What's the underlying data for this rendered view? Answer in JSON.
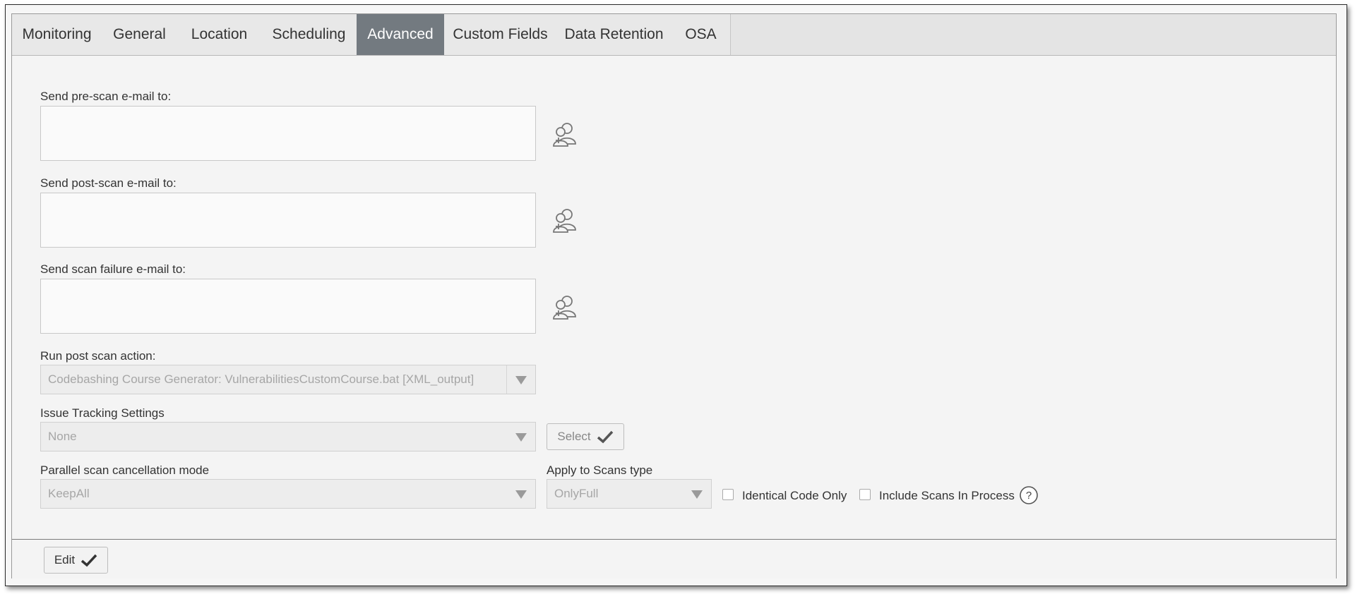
{
  "tabs": {
    "monitoring": "Monitoring",
    "general": "General",
    "location": "Location",
    "scheduling": "Scheduling",
    "advanced": "Advanced",
    "custom_fields": "Custom Fields",
    "data_retention": "Data Retention",
    "osa": "OSA"
  },
  "active_tab": "Advanced",
  "form": {
    "pre_scan_label": "Send pre-scan e-mail to:",
    "post_scan_label": "Send post-scan e-mail to:",
    "failure_label": "Send scan failure e-mail to:",
    "pre_scan_value": "",
    "post_scan_value": "",
    "failure_value": "",
    "post_action_label": "Run post scan action:",
    "post_action_value": "Codebashing Course Generator: VulnerabilitiesCustomCourse.bat [XML_output]",
    "issue_tracking_label": "Issue Tracking Settings",
    "issue_tracking_value": "None",
    "select_button": "Select",
    "parallel_label": "Parallel scan cancellation mode",
    "parallel_value": "KeepAll",
    "apply_label": "Apply to Scans type",
    "apply_value": "OnlyFull",
    "identical_code_label": "Identical Code Only",
    "identical_code_checked": false,
    "include_scans_label": "Include Scans In Process",
    "include_scans_checked": false,
    "help_icon": "?"
  },
  "footer": {
    "edit_button": "Edit"
  },
  "icons": {
    "add_recipients": "add-users-icon",
    "check": "checkmark-icon",
    "dropdown": "chevron-down-icon",
    "help": "question-circle-icon"
  },
  "colors": {
    "active_tab_bg": "#737a80",
    "tab_bg": "#e8e8e8",
    "panel_bg": "#f4f4f4"
  }
}
